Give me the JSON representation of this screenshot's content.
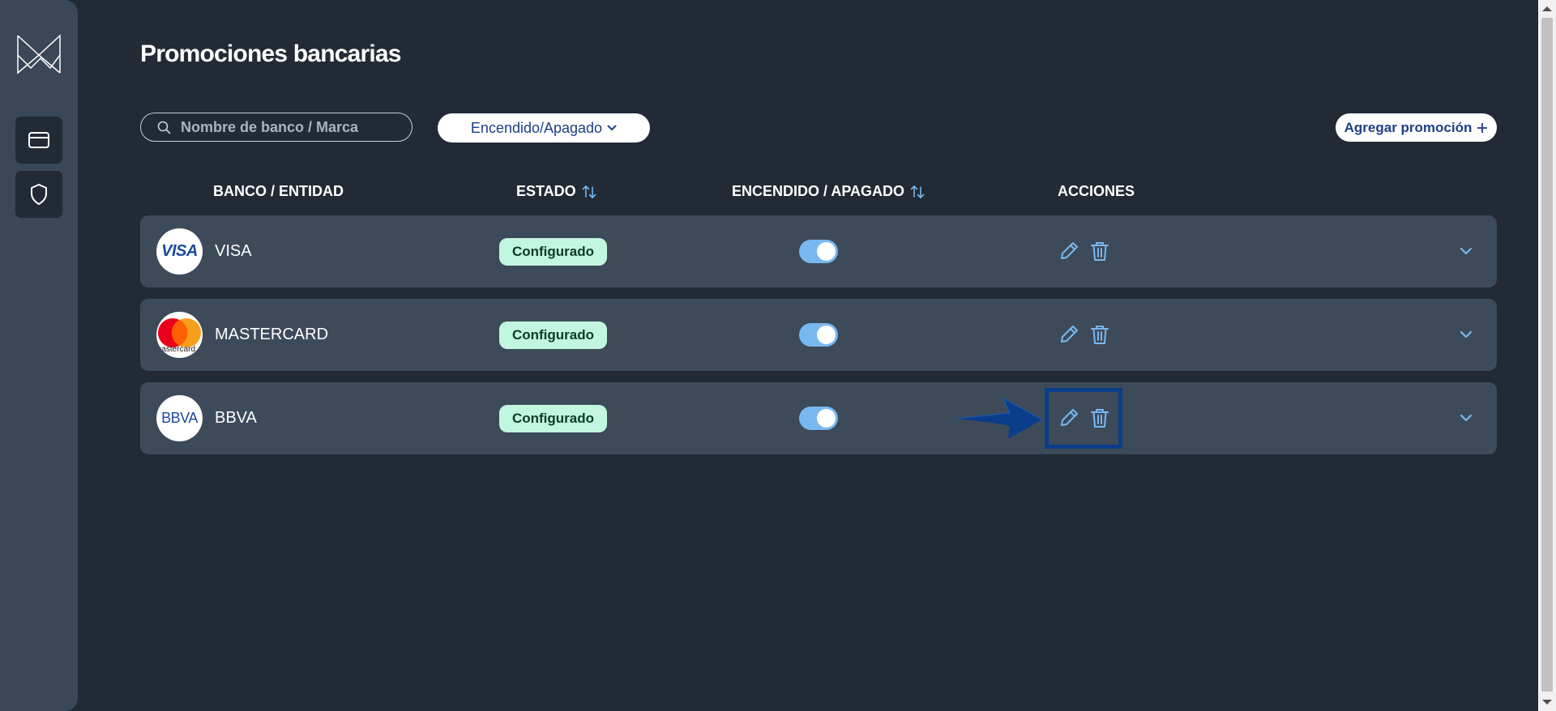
{
  "page": {
    "title": "Promociones bancarias"
  },
  "search": {
    "placeholder": "Nombre de banco / Marca"
  },
  "filter": {
    "label": "Encendido/Apagado"
  },
  "add_button": {
    "label": "Agregar promoción"
  },
  "table": {
    "headers": {
      "bank": "BANCO / ENTIDAD",
      "status": "ESTADO",
      "onoff": "ENCENDIDO / APAGADO",
      "actions": "ACCIONES"
    },
    "rows": [
      {
        "name": "VISA",
        "logo_text": "VISA",
        "status": "Configurado",
        "enabled": true
      },
      {
        "name": "MASTERCARD",
        "logo_text": "mastercard",
        "status": "Configurado",
        "enabled": true
      },
      {
        "name": "BBVA",
        "logo_text": "BBVA",
        "status": "Configurado",
        "enabled": true
      }
    ]
  },
  "colors": {
    "background": "#212a35",
    "sidebar": "#3a4756",
    "row": "#3d4a59",
    "badge": "#c3f6e0",
    "toggle_on": "#78b8f0",
    "icon_accent": "#78b8f0",
    "annotation": "#0a3d8a"
  },
  "icons": {
    "sidebar": [
      "app-logo-icon",
      "credit-card-icon",
      "shield-icon"
    ],
    "row_actions": [
      "pencil-icon",
      "trash-icon",
      "chevron-down-icon"
    ]
  }
}
